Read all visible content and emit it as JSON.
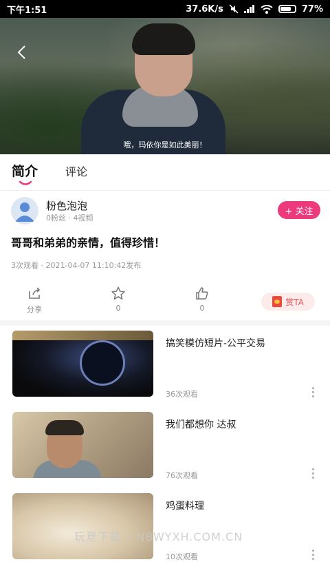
{
  "status_bar": {
    "time": "下午1:51",
    "network_speed": "37.6K/s",
    "battery": "77%",
    "battery_level": 0.77
  },
  "video": {
    "subtitle": "哦，玛依你是如此美丽！"
  },
  "tabs": [
    {
      "label": "简介"
    },
    {
      "label": "评论"
    }
  ],
  "author": {
    "name": "粉色泡泡",
    "stats": "0粉丝 · 4视频",
    "follow_label": "+ 关注"
  },
  "title": "哥哥和弟弟的亲情，值得珍惜！",
  "meta": "3次观看 · 2021-04-07 11:10:42发布",
  "actions": {
    "share_label": "分享",
    "favorite_count": "0",
    "like_count": "0",
    "reward_label": "赏TA"
  },
  "related": [
    {
      "title": "搞笑模仿短片-公平交易",
      "views": "36次观看"
    },
    {
      "title": "我们都想你 达叔",
      "views": "76次观看"
    },
    {
      "title": "鸡蛋料理",
      "views": "10次观看"
    }
  ],
  "watermark": "玩意下载 • NBWYXH.COM.CN",
  "colors": {
    "accent": "#ec3a7c",
    "reward": "#e85a5a"
  }
}
